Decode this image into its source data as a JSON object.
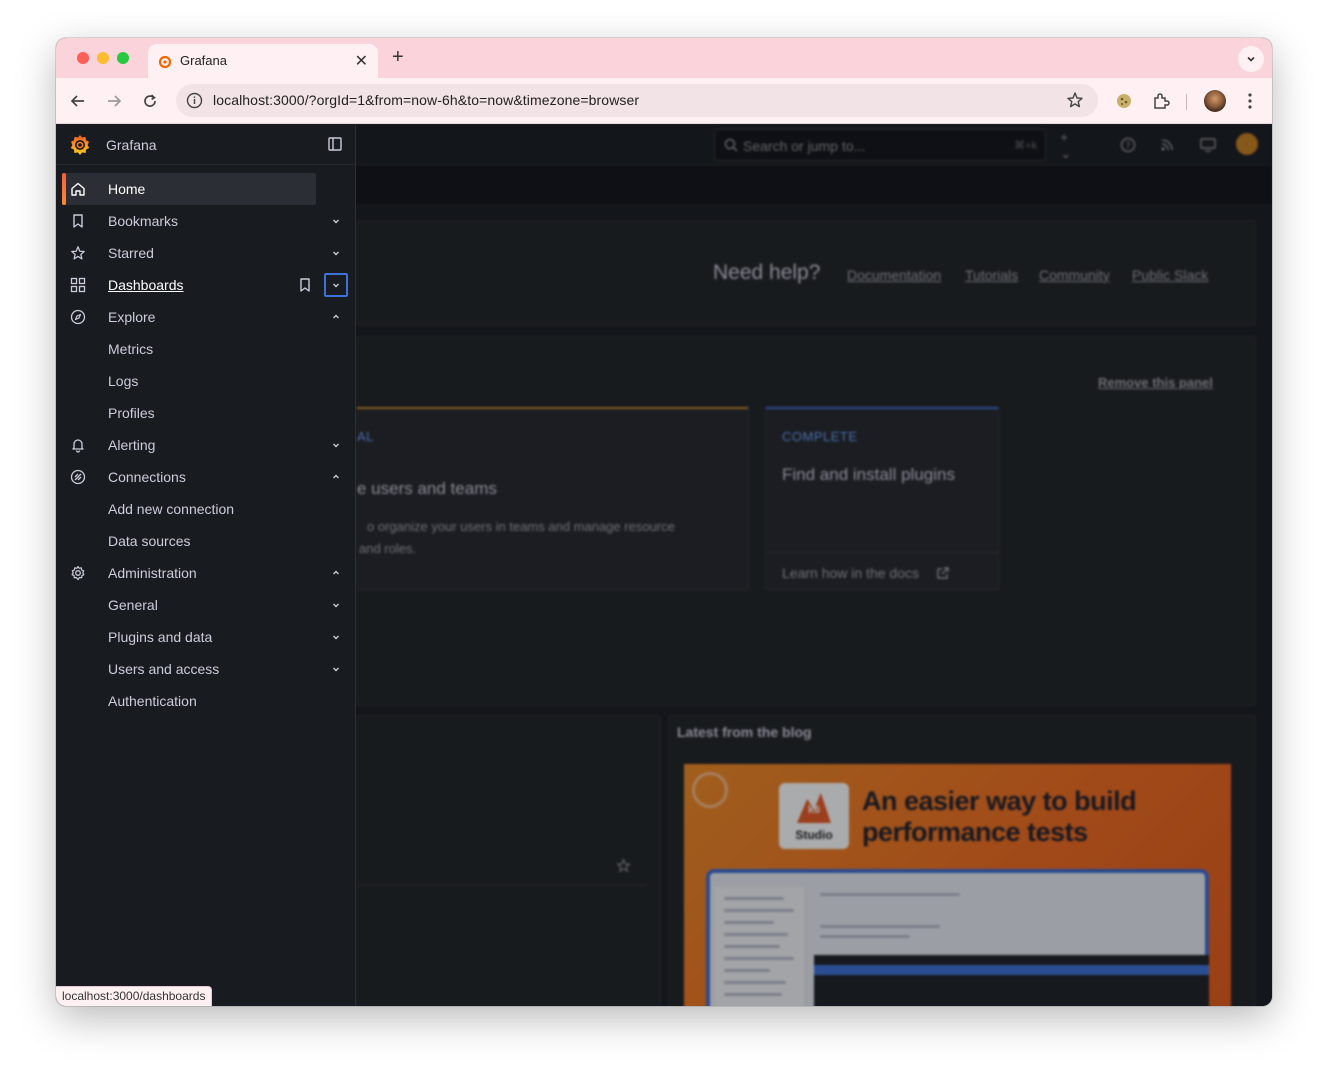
{
  "browser": {
    "tab_title": "Grafana",
    "url": "localhost:3000/?orgId=1&from=now-6h&to=now&timezone=browser",
    "status_url": "localhost:3000/dashboards"
  },
  "topbar": {
    "search_placeholder": "Search or jump to...",
    "search_shortcut": "⌘+k"
  },
  "background": {
    "help_title": "Need help?",
    "help_links": [
      "Documentation",
      "Tutorials",
      "Community",
      "Public Slack"
    ],
    "remove_panel": "Remove this panel",
    "card_left": {
      "label": "AL",
      "title": "e users and teams",
      "desc_line1": "o organize your users in teams and manage resource",
      "desc_line2": "and roles."
    },
    "card_right": {
      "label": "COMPLETE",
      "title": "Find and install plugins",
      "footer": "Learn how in the docs"
    },
    "blog_title": "Latest from the blog",
    "blog_headline_line1": "An easier way to build",
    "blog_headline_line2": "performance tests",
    "blog_box_text": "Studio",
    "blog_box_mark": "k6",
    "colors": {
      "orange": "#f26a1e",
      "blue": "#3d71d9",
      "label_blue": "#6e9fff",
      "label_orange": "#e08a3c"
    }
  },
  "sidebar": {
    "brand": "Grafana",
    "items": [
      {
        "label": "Home",
        "icon": "home-icon",
        "chevron": ""
      },
      {
        "label": "Bookmarks",
        "icon": "bookmark-icon",
        "chevron": "down"
      },
      {
        "label": "Starred",
        "icon": "star-icon",
        "chevron": "down"
      },
      {
        "label": "Dashboards",
        "icon": "apps-icon",
        "chevron": "down"
      },
      {
        "label": "Explore",
        "icon": "compass-icon",
        "chevron": "up"
      },
      {
        "label": "Metrics",
        "icon": "",
        "chevron": ""
      },
      {
        "label": "Logs",
        "icon": "",
        "chevron": ""
      },
      {
        "label": "Profiles",
        "icon": "",
        "chevron": ""
      },
      {
        "label": "Alerting",
        "icon": "bell-icon",
        "chevron": "down"
      },
      {
        "label": "Connections",
        "icon": "connections-icon",
        "chevron": "up"
      },
      {
        "label": "Add new connection",
        "icon": "",
        "chevron": ""
      },
      {
        "label": "Data sources",
        "icon": "",
        "chevron": ""
      },
      {
        "label": "Administration",
        "icon": "cog-icon",
        "chevron": "up"
      },
      {
        "label": "General",
        "icon": "",
        "chevron": "down"
      },
      {
        "label": "Plugins and data",
        "icon": "",
        "chevron": "down"
      },
      {
        "label": "Users and access",
        "icon": "",
        "chevron": "down"
      },
      {
        "label": "Authentication",
        "icon": "",
        "chevron": ""
      }
    ]
  }
}
